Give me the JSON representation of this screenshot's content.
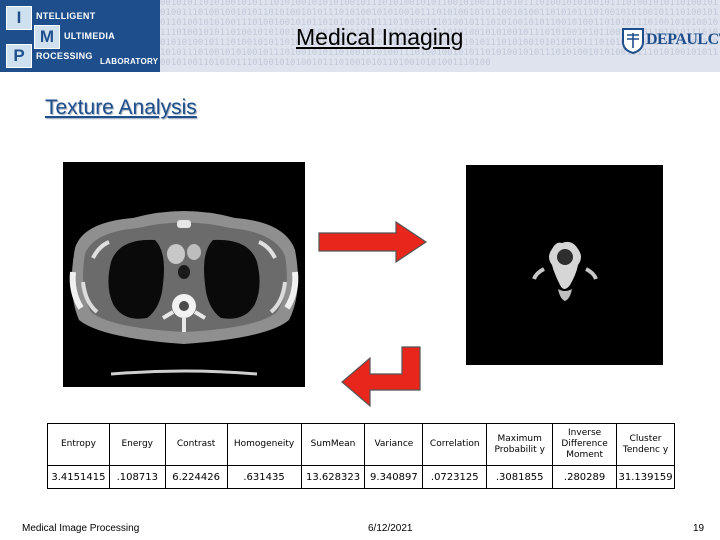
{
  "header": {
    "title": "Medical Imaging",
    "bits": "0010101101010010101110101001010101001011101010010101100101001101010111010010101001011101001010110100101010011101001001010110101001010111010100101010010111010100101011001010011010101110100101010010111010010101101001010100111010010010101101010010101110101001010100101110101001010110010100110101011101001010100101110100101011010010101001110100100101011010100101011101010010101001011101010010101100101001101010111010010101001011101001010110100101010011101001001010110101001010111010100101010010111010100101011001010011010101110100101010010111010010101101001010100111010010010101101010010101110101001010100101110101001010110010100110101011101001010100101110100101011010010101001110100",
    "imp_logo": {
      "letters": [
        "I",
        "M",
        "P"
      ],
      "words": [
        "NTELLIGENT",
        "ULTIMEDIA",
        "ROCESSING",
        "LABORATORY"
      ]
    },
    "depaul_logo": "DEPAULCTI"
  },
  "slide": {
    "section_title": "Texture Analysis"
  },
  "figures": {
    "ct_full_alt": "Chest CT slice",
    "ct_crop_alt": "Segmented vertebra region",
    "arrow_right_icon": "arrow-right-icon",
    "arrow_corner_icon": "arrow-down-left-icon"
  },
  "features_table": {
    "headers": [
      "Entropy",
      "Energy",
      "Contrast",
      "Homogeneity",
      "SumMean",
      "Variance",
      "Correlation",
      "Maximum Probabilit y",
      "Inverse Difference Moment",
      "Cluster Tendenc y"
    ],
    "values": [
      "3.4151415",
      ".108713",
      "6.224426",
      ".631435",
      "13.628323",
      "9.340897",
      ".0723125",
      ".3081855",
      ".280289",
      "31.139159"
    ]
  },
  "footer": {
    "left": "Medical Image Processing",
    "center": "6/12/2021",
    "right": "19"
  },
  "colors": {
    "accent": "#1e4f8c",
    "arrow_red": "#e8261c"
  }
}
